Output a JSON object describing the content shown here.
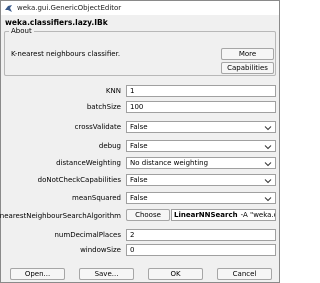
{
  "window": {
    "title": "weka.gui.GenericObjectEditor",
    "class_name": "weka.classifiers.lazy.IBk"
  },
  "about": {
    "legend": "About",
    "description": "K-nearest neighbours classifier.",
    "more_label": "More",
    "capabilities_label": "Capabilities"
  },
  "properties": {
    "knn": {
      "label": "KNN",
      "value": "1"
    },
    "batch_size": {
      "label": "batchSize",
      "value": "100"
    },
    "cross_validate": {
      "label": "crossValidate",
      "value": "False"
    },
    "debug": {
      "label": "debug",
      "value": "False"
    },
    "distance_weighting": {
      "label": "distanceWeighting",
      "value": "No distance weighting"
    },
    "do_not_check_capabilities": {
      "label": "doNotCheckCapabilities",
      "value": "False"
    },
    "mean_squared": {
      "label": "meanSquared",
      "value": "False"
    },
    "nn_search": {
      "label": "nearestNeighbourSearchAlgorithm",
      "choose_label": "Choose",
      "algorithm": "LinearNNSearch",
      "options": "-A \"weka.core."
    },
    "num_decimal_places": {
      "label": "numDecimalPlaces",
      "value": "2"
    },
    "window_size": {
      "label": "windowSize",
      "value": "0"
    }
  },
  "buttons": {
    "open": "Open...",
    "save": "Save...",
    "ok": "OK",
    "cancel": "Cancel"
  },
  "icons": {
    "app": "weka-bird-icon",
    "dropdown": "chevron-down-icon"
  }
}
